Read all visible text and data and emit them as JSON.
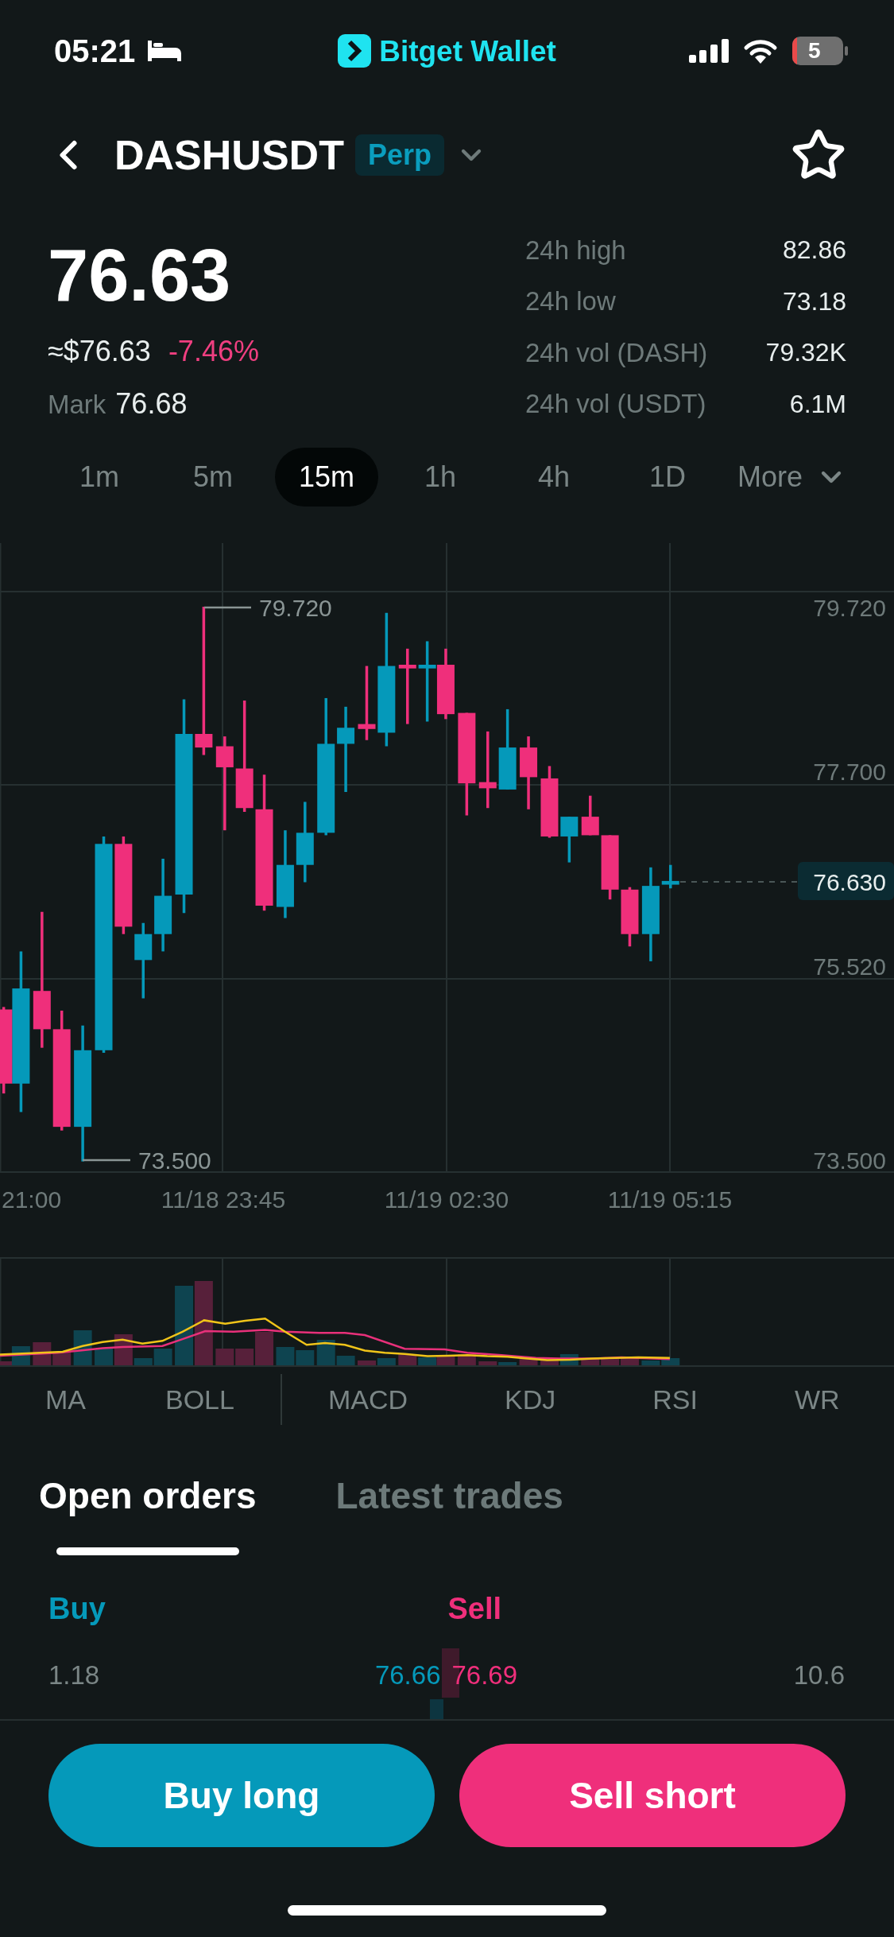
{
  "status_bar": {
    "time": "05:21",
    "app_name": "Bitget Wallet",
    "battery": "5"
  },
  "header": {
    "symbol": "DASHUSDT",
    "badge": "Perp",
    "favorited": false
  },
  "price": {
    "last": "76.63",
    "usd": "≈$76.63",
    "change": "-7.46%",
    "mark_label": "Mark",
    "mark": "76.68"
  },
  "stats": [
    {
      "label": "24h high",
      "value": "82.86"
    },
    {
      "label": "24h low",
      "value": "73.18"
    },
    {
      "label": "24h vol (DASH)",
      "value": "79.32K"
    },
    {
      "label": "24h vol (USDT)",
      "value": "6.1M"
    }
  ],
  "intervals": [
    {
      "label": "1m",
      "kind": "option",
      "selected": false
    },
    {
      "label": "5m",
      "kind": "option",
      "selected": false
    },
    {
      "label": "15m",
      "kind": "option",
      "selected": true
    },
    {
      "label": "1h",
      "kind": "option",
      "selected": false
    },
    {
      "label": "4h",
      "kind": "option",
      "selected": false
    },
    {
      "label": "1D",
      "kind": "option",
      "selected": false
    },
    {
      "label": "More",
      "kind": "menu",
      "selected": false
    }
  ],
  "chart": {
    "price_axis": [
      "79.720",
      "77.700",
      "75.520",
      "73.500"
    ],
    "high_marker": "79.720",
    "low_marker": "73.500",
    "last_price": "76.630",
    "time_axis": [
      "21:00",
      "11/18 23:45",
      "11/19 02:30",
      "11/19 05:15"
    ]
  },
  "indicators": {
    "main": [
      {
        "label": "MA",
        "selected": false
      },
      {
        "label": "BOLL",
        "selected": false
      }
    ],
    "sub": [
      {
        "label": "MACD",
        "selected": false
      },
      {
        "label": "KDJ",
        "selected": false
      },
      {
        "label": "RSI",
        "selected": false
      },
      {
        "label": "WR",
        "selected": false
      }
    ]
  },
  "order_tabs": [
    {
      "label": "Open orders",
      "selected": true
    },
    {
      "label": "Latest trades",
      "selected": false
    }
  ],
  "order_book": {
    "buy_label": "Buy",
    "sell_label": "Sell",
    "rows": [
      {
        "buy": {
          "amount": "1.18",
          "price": "76.66"
        },
        "sell": {
          "price": "76.69",
          "amount": "10.6"
        }
      }
    ]
  },
  "actions": [
    {
      "label": "Buy long",
      "kind": "buy"
    },
    {
      "label": "Sell short",
      "kind": "sell"
    }
  ]
}
